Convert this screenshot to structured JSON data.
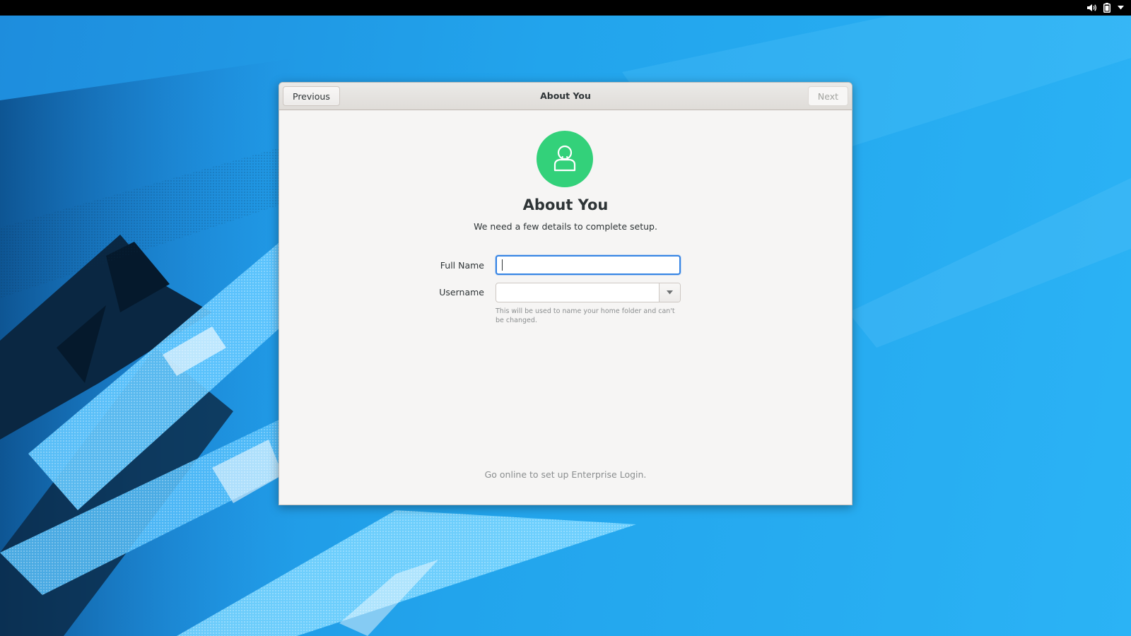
{
  "topbar": {
    "tray": [
      {
        "icon": "volume-icon"
      },
      {
        "icon": "battery-icon"
      },
      {
        "icon": "chevron-down-icon"
      }
    ]
  },
  "window": {
    "title": "About You",
    "previous_label": "Previous",
    "next_label": "Next",
    "next_enabled": false
  },
  "page": {
    "avatar_icon": "user-avatar-icon",
    "avatar_color": "#33d17a",
    "heading": "About You",
    "subtitle": "We need a few details to complete setup."
  },
  "form": {
    "full_name": {
      "label": "Full Name",
      "value": "",
      "focused": true
    },
    "username": {
      "label": "Username",
      "value": "",
      "hint": "This will be used to name your home folder and can't be changed."
    }
  },
  "footer": {
    "text": "Go online to set up Enterprise Login."
  },
  "colors": {
    "accent": "#3584e4",
    "wallpaper_blue": "#2bb3f5",
    "window_bg": "#f6f5f4"
  }
}
